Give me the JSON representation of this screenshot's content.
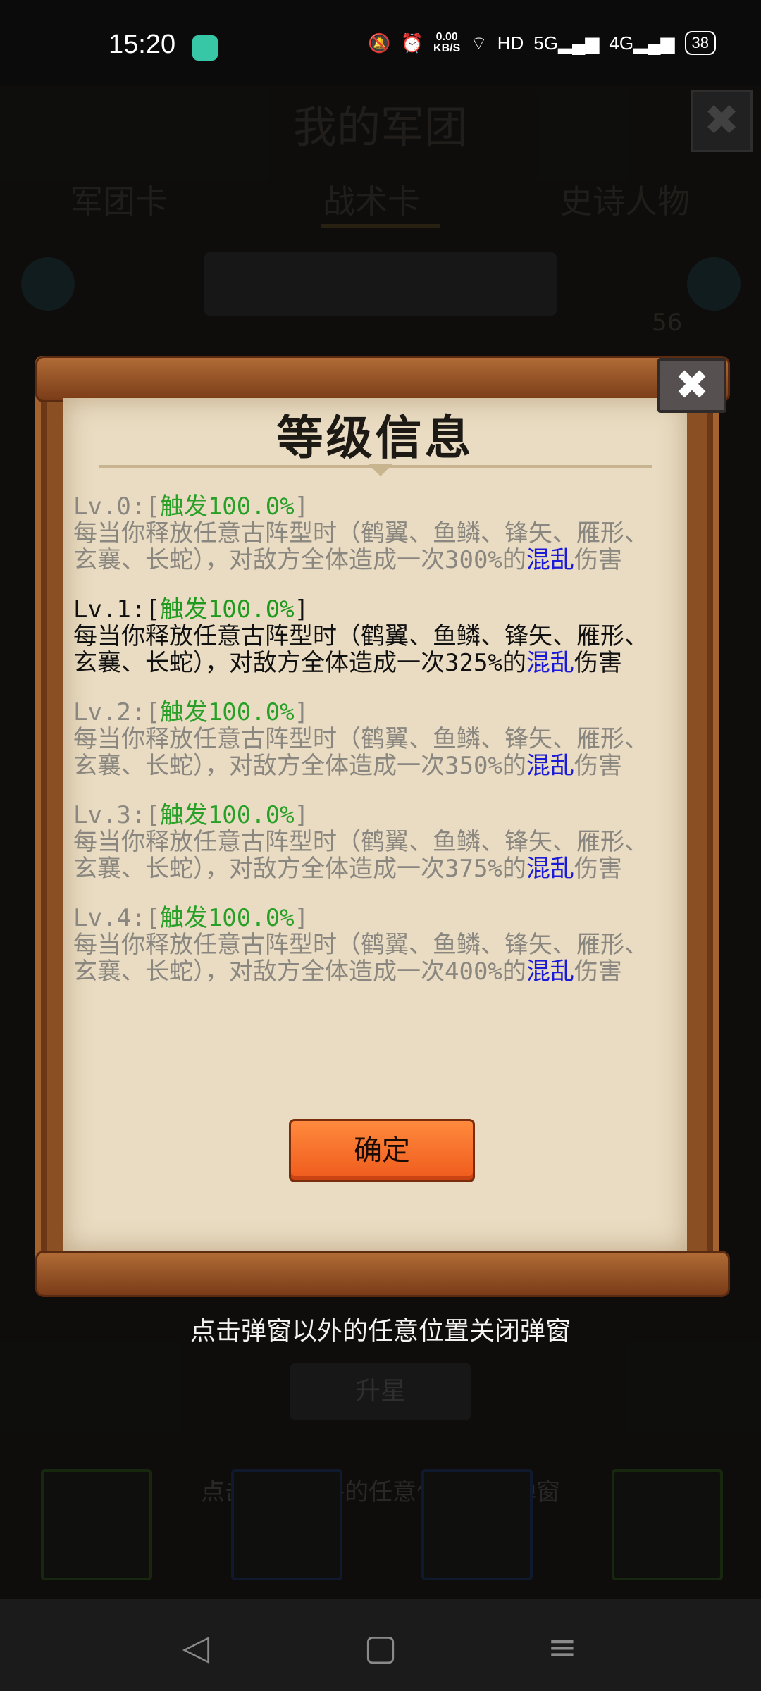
{
  "status_bar": {
    "time": "15:20",
    "net_speed_value": "0.00",
    "net_speed_unit": "KB/S",
    "hd_label": "HD",
    "net1": "5G",
    "net2": "4G",
    "battery": "38"
  },
  "background": {
    "window_title": "我的军团",
    "tabs": [
      "军团卡",
      "战术卡",
      "史诗人物"
    ],
    "count": "56",
    "upgrade_button": "升星",
    "close_hint": "点击弹窗以外的任意位置关闭弹窗"
  },
  "modal": {
    "title": "等级信息",
    "levels": [
      {
        "label": "Lv.0:[",
        "tag": "触发100.0%",
        "tail": "]",
        "desc": "每当你释放任意古阵型时（鹤翼、鱼鳞、锋矢、雁形、玄襄、长蛇），对敌方全体造成一次300%的",
        "status": "混乱",
        "desc_end": "伤害"
      },
      {
        "label": "Lv.1:[",
        "tag": "触发100.0%",
        "tail": "]",
        "desc": "每当你释放任意古阵型时（鹤翼、鱼鳞、锋矢、雁形、玄襄、长蛇），对敌方全体造成一次325%的",
        "status": "混乱",
        "desc_end": "伤害"
      },
      {
        "label": "Lv.2:[",
        "tag": "触发100.0%",
        "tail": "]",
        "desc": "每当你释放任意古阵型时（鹤翼、鱼鳞、锋矢、雁形、玄襄、长蛇），对敌方全体造成一次350%的",
        "status": "混乱",
        "desc_end": "伤害"
      },
      {
        "label": "Lv.3:[",
        "tag": "触发100.0%",
        "tail": "]",
        "desc": "每当你释放任意古阵型时（鹤翼、鱼鳞、锋矢、雁形、玄襄、长蛇），对敌方全体造成一次375%的",
        "status": "混乱",
        "desc_end": "伤害"
      },
      {
        "label": "Lv.4:[",
        "tag": "触发100.0%",
        "tail": "]",
        "desc": "每当你释放任意古阵型时（鹤翼、鱼鳞、锋矢、雁形、玄襄、长蛇），对敌方全体造成一次400%的",
        "status": "混乱",
        "desc_end": "伤害"
      }
    ],
    "confirm_button": "确定",
    "outside_hint": "点击弹窗以外的任意位置关闭弹窗"
  },
  "colors": {
    "trigger_green": "#28a028",
    "status_blue": "#1a1ad8",
    "confirm_orange": "#ef5a1c",
    "parchment": "#e9dcc2"
  }
}
